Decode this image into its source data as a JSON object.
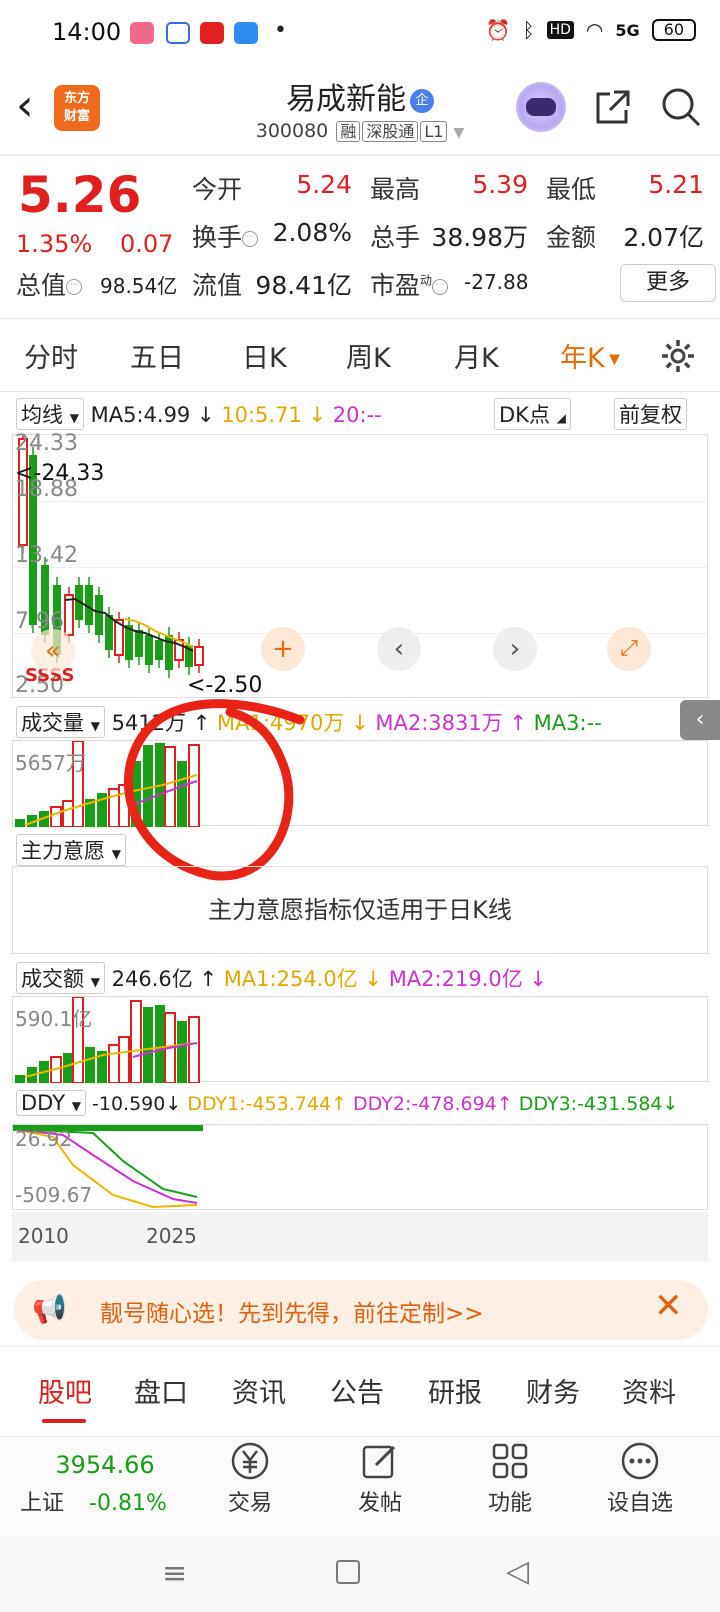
{
  "status_bar": {
    "time": "14:00",
    "network": "5G",
    "battery": "60"
  },
  "header": {
    "stock_name": "易成新能",
    "enterprise_badge": "企",
    "stock_code": "300080",
    "tags": [
      "融",
      "深股通",
      "L1"
    ],
    "logo_text": [
      "东方",
      "财富"
    ]
  },
  "quote": {
    "price": "5.26",
    "change_pct": "1.35%",
    "change": "0.07",
    "items": [
      {
        "label": "今开",
        "value": "5.24"
      },
      {
        "label": "最高",
        "value": "5.39"
      },
      {
        "label": "最低",
        "value": "5.21"
      },
      {
        "label": "换手",
        "value": "2.08%"
      },
      {
        "label": "总手",
        "value": "38.98万"
      },
      {
        "label": "金额",
        "value": "2.07亿"
      },
      {
        "label": "总值",
        "value": "98.54亿"
      },
      {
        "label": "流值",
        "value": "98.41亿"
      },
      {
        "label": "市盈",
        "value": "-27.88",
        "sup": "动"
      }
    ],
    "more_label": "更多"
  },
  "period_tabs": [
    "分时",
    "五日",
    "日K",
    "周K",
    "月K",
    "年K"
  ],
  "kline": {
    "ma_selector": "均线",
    "ma5": "MA5:4.99",
    "ma10": "10:5.71",
    "ma20": "20:--",
    "dk_label": "DK点",
    "fq_label": "前复权",
    "y_labels": [
      "24.33",
      "18.88",
      "13.42",
      "7.96",
      "2.50"
    ],
    "max_label": "<-24.33",
    "min_label": "<-2.50",
    "colors": {
      "up": "#e02020",
      "down": "#1a9e1a",
      "ma5": "#222222",
      "ma10": "#e8b800",
      "ma20": "#cc33cc"
    }
  },
  "volume": {
    "selector": "成交量",
    "value": "5412万",
    "ma1": "MA1:4970万",
    "ma2": "MA2:3831万",
    "ma3": "MA3:--",
    "y_label": "5657万"
  },
  "main_intent": {
    "selector": "主力意愿",
    "tip": "主力意愿指标仅适用于日K线"
  },
  "amount": {
    "selector": "成交额",
    "value": "246.6亿",
    "ma1": "MA1:254.0亿",
    "ma2": "MA2:219.0亿",
    "y_label": "590.1亿"
  },
  "ddy": {
    "selector": "DDY",
    "value": "-10.590",
    "ddy1": "DDY1:-453.744",
    "ddy2": "DDY2:-478.694",
    "ddy3": "DDY3:-431.584",
    "y_top": "26.92",
    "y_bottom": "-509.67",
    "x_labels": [
      "2010",
      "2025"
    ]
  },
  "ad": {
    "text": "靓号随心选！先到先得，前往定制>>"
  },
  "bottom_tabs": [
    "股吧",
    "盘口",
    "资讯",
    "公告",
    "研报",
    "财务",
    "资料"
  ],
  "bottom_nav": {
    "index_value": "3954.66",
    "index_name": "上证",
    "index_change": "-0.81%",
    "items": [
      "交易",
      "发帖",
      "功能",
      "设自选"
    ]
  }
}
